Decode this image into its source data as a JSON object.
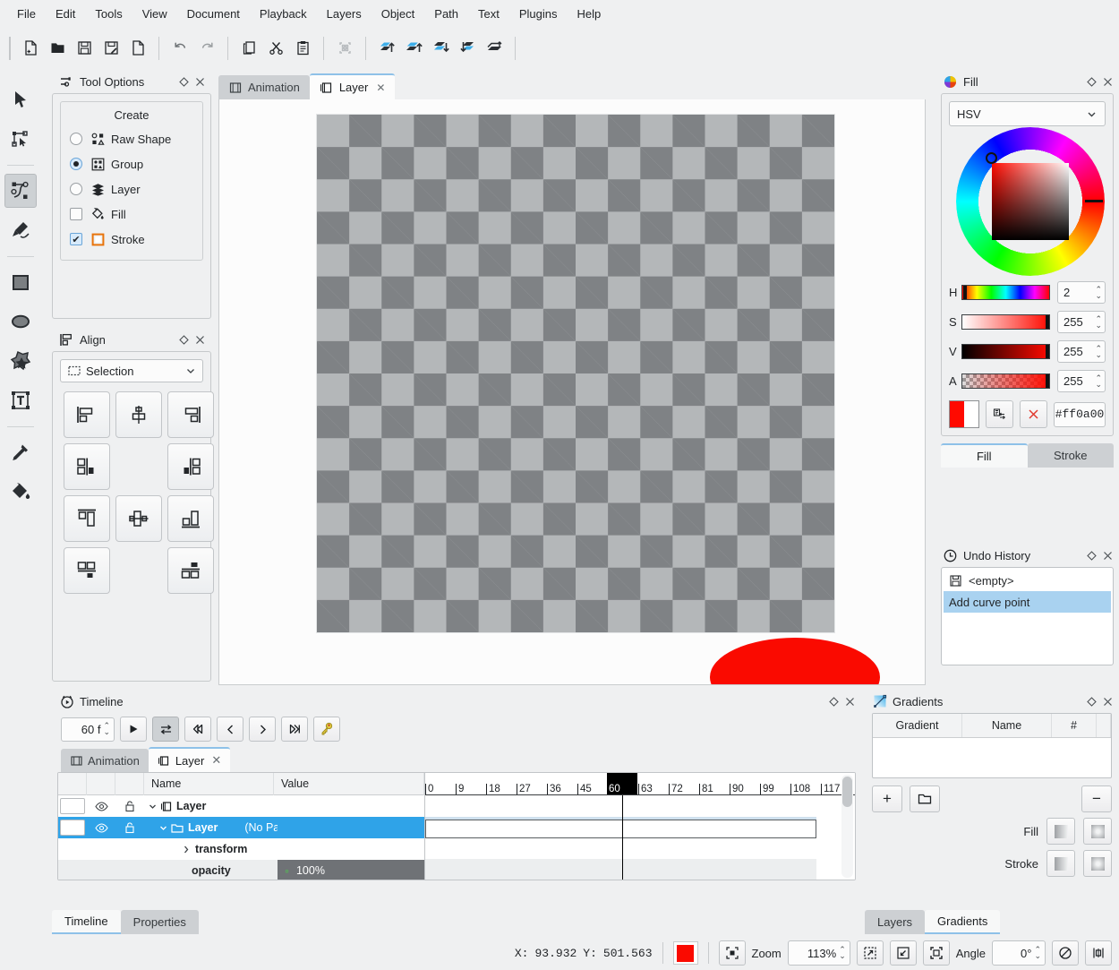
{
  "menubar": {
    "items": [
      "File",
      "Edit",
      "Tools",
      "View",
      "Document",
      "Playback",
      "Layers",
      "Object",
      "Path",
      "Text",
      "Plugins",
      "Help"
    ]
  },
  "toolbar": {
    "buttons": [
      {
        "name": "new-document",
        "icon": "page-plus-icon"
      },
      {
        "name": "open-document",
        "icon": "folder-open-icon"
      },
      {
        "name": "save",
        "icon": "save-icon"
      },
      {
        "name": "save-as",
        "icon": "save-as-icon"
      },
      {
        "name": "export",
        "icon": "page-export-icon"
      },
      {
        "name": "undo",
        "icon": "undo-arrow-icon"
      },
      {
        "name": "redo",
        "icon": "redo-arrow-icon"
      },
      {
        "name": "copy",
        "icon": "copy-icon"
      },
      {
        "name": "cut",
        "icon": "scissors-icon"
      },
      {
        "name": "paste",
        "icon": "clipboard-icon"
      },
      {
        "name": "select-all",
        "icon": "select-all-icon"
      },
      {
        "name": "raise-to-top",
        "icon": "raise-to-top-icon"
      },
      {
        "name": "raise",
        "icon": "raise-icon"
      },
      {
        "name": "lower",
        "icon": "lower-icon"
      },
      {
        "name": "lower-to-bottom",
        "icon": "lower-to-bottom-icon"
      },
      {
        "name": "move-to-layer",
        "icon": "move-to-layer-icon"
      }
    ]
  },
  "tools": [
    {
      "name": "select-tool",
      "icon": "cursor-arrow-icon",
      "active": false
    },
    {
      "name": "node-edit-tool",
      "icon": "node-edit-icon",
      "active": false
    },
    {
      "name": "pen-tool",
      "icon": "bezier-path-icon",
      "active": true
    },
    {
      "name": "pencil-tool",
      "icon": "pencil-draw-icon",
      "active": false
    },
    {
      "name": "rectangle-tool",
      "icon": "rectangle-icon",
      "active": false
    },
    {
      "name": "ellipse-tool",
      "icon": "ellipse-icon",
      "active": false
    },
    {
      "name": "star-tool",
      "icon": "star-polygon-icon",
      "active": false
    },
    {
      "name": "text-tool",
      "icon": "text-box-icon",
      "active": false
    },
    {
      "name": "eyedropper-tool",
      "icon": "eyedropper-icon",
      "active": false
    },
    {
      "name": "paint-bucket-tool",
      "icon": "paint-bucket-icon",
      "active": false
    }
  ],
  "tool_options": {
    "title": "Tool Options",
    "group_title": "Create",
    "options": [
      {
        "label": "Raw Shape",
        "type": "radio",
        "checked": false,
        "icon": "raw-shape-icon"
      },
      {
        "label": "Group",
        "type": "radio",
        "checked": true,
        "icon": "group-icon"
      },
      {
        "label": "Layer",
        "type": "radio",
        "checked": false,
        "icon": "layer-stack-icon"
      },
      {
        "label": "Fill",
        "type": "checkbox",
        "checked": false,
        "icon": "fill-bucket-icon"
      },
      {
        "label": "Stroke",
        "type": "checkbox",
        "checked": true,
        "icon": "stroke-square-icon"
      }
    ]
  },
  "align": {
    "title": "Align",
    "target": "Selection",
    "buttons": [
      {
        "name": "align-left-edges",
        "icon": "align-left-icon"
      },
      {
        "name": "align-horizontal-center",
        "icon": "align-hcenter-icon"
      },
      {
        "name": "align-right-edges",
        "icon": "align-right-icon"
      },
      {
        "name": "align-left-to-right",
        "icon": "align-left-to-right-icon"
      },
      {
        "name": "align-right-to-left",
        "icon": "align-right-to-left-icon"
      },
      {
        "name": "align-top-edges",
        "icon": "align-top-icon"
      },
      {
        "name": "align-vertical-center",
        "icon": "align-vcenter-icon"
      },
      {
        "name": "align-bottom-edges",
        "icon": "align-bottom-icon"
      },
      {
        "name": "align-top-to-bottom",
        "icon": "align-top-to-bottom-icon"
      },
      {
        "name": "align-bottom-to-top",
        "icon": "align-bottom-to-top-icon"
      }
    ]
  },
  "canvas": {
    "tabs": [
      {
        "label": "Animation",
        "icon": "film-strip-icon",
        "active": false,
        "closable": false
      },
      {
        "label": "Layer",
        "icon": "layer-frame-icon",
        "active": true,
        "closable": true
      }
    ],
    "shape_fill": "#fa0a00",
    "stroke_color": "#ffffff"
  },
  "fill_panel": {
    "title": "Fill",
    "color_model": "HSV",
    "sliders": [
      {
        "label": "H",
        "value": "2"
      },
      {
        "label": "S",
        "value": "255"
      },
      {
        "label": "V",
        "value": "255"
      },
      {
        "label": "A",
        "value": "255"
      }
    ],
    "hex": "#ff0a00",
    "current_color": "#ff0a00",
    "swap_button": "swap-colors-icon",
    "clear_button": "clear-color-icon",
    "tabs": [
      {
        "label": "Fill",
        "active": true
      },
      {
        "label": "Stroke",
        "active": false
      }
    ]
  },
  "undo_history": {
    "title": "Undo History",
    "items": [
      {
        "label": "<empty>",
        "icon": "save-icon",
        "selected": false
      },
      {
        "label": "Add curve point",
        "icon": "",
        "selected": true
      }
    ]
  },
  "timeline": {
    "title": "Timeline",
    "frame_count": "60 f",
    "controls": [
      {
        "name": "play-button",
        "icon": "play-icon",
        "active": false
      },
      {
        "name": "loop-button",
        "icon": "loop-icon",
        "active": true
      },
      {
        "name": "first-frame-button",
        "icon": "skip-first-icon",
        "active": false
      },
      {
        "name": "previous-frame-button",
        "icon": "prev-icon",
        "active": false
      },
      {
        "name": "next-frame-button",
        "icon": "next-icon",
        "active": false
      },
      {
        "name": "last-frame-button",
        "icon": "skip-last-icon",
        "active": false
      },
      {
        "name": "keyframe-button",
        "icon": "key-icon",
        "active": false
      }
    ],
    "tabs": [
      {
        "label": "Animation",
        "icon": "film-strip-icon",
        "active": false,
        "closable": false
      },
      {
        "label": "Layer",
        "icon": "layer-frame-icon",
        "active": true,
        "closable": true
      }
    ],
    "columns": [
      "Name",
      "Value"
    ],
    "rows": [
      {
        "name": "Layer",
        "value": "",
        "parent": "",
        "icon": "layer-frame-icon",
        "indent": 0,
        "selected": false,
        "has_swatch": true,
        "has_eye": true,
        "has_lock": true,
        "expanded": true
      },
      {
        "name": "Layer",
        "value": "",
        "parent": "(No Parent)",
        "icon": "folder-icon",
        "indent": 1,
        "selected": true,
        "has_swatch": true,
        "has_eye": true,
        "has_lock": true,
        "expanded": true
      },
      {
        "name": "transform",
        "value": "",
        "parent": "",
        "icon": "",
        "indent": 2,
        "selected": false,
        "has_swatch": false,
        "has_eye": false,
        "has_lock": false,
        "expanded": false
      },
      {
        "name": "opacity",
        "value": "100%",
        "parent": "",
        "icon": "",
        "indent": 2,
        "selected": false,
        "has_swatch": false,
        "has_eye": false,
        "has_lock": false,
        "expanded": false
      }
    ],
    "ruler_ticks": [
      "0",
      "9",
      "18",
      "27",
      "36",
      "45",
      "60",
      "63",
      "72",
      "81",
      "90",
      "99",
      "108",
      "117"
    ],
    "playhead_frame": "60"
  },
  "bottom_tabs": [
    {
      "label": "Timeline",
      "active": true
    },
    {
      "label": "Properties",
      "active": false
    }
  ],
  "gradients": {
    "title": "Gradients",
    "columns": [
      "Gradient",
      "Name",
      "#"
    ],
    "rows": [],
    "add_button": "+",
    "remove_button": "−",
    "folder_button": "folder-icon",
    "fill_label": "Fill",
    "stroke_label": "Stroke"
  },
  "right_bottom_tabs": [
    {
      "label": "Layers",
      "active": false
    },
    {
      "label": "Gradients",
      "active": true
    }
  ],
  "statusbar": {
    "x_label": "X:",
    "x_value": "93.932",
    "y_label": "Y:",
    "y_value": "501.563",
    "color": "#fa0a00",
    "zoom_label": "Zoom",
    "zoom_value": "113%",
    "angle_label": "Angle",
    "angle_value": "0°",
    "buttons": [
      {
        "name": "fit-selection-button",
        "icon": "fit-selection-icon"
      },
      {
        "name": "zoom-fit-button",
        "icon": "zoom-fit-icon"
      },
      {
        "name": "zoom-actual-button",
        "icon": "zoom-actual-icon"
      },
      {
        "name": "zoom-page-button",
        "icon": "zoom-page-icon"
      },
      {
        "name": "flip-button",
        "icon": "flip-icon"
      },
      {
        "name": "snapping-button",
        "icon": "snapping-icon"
      }
    ]
  }
}
